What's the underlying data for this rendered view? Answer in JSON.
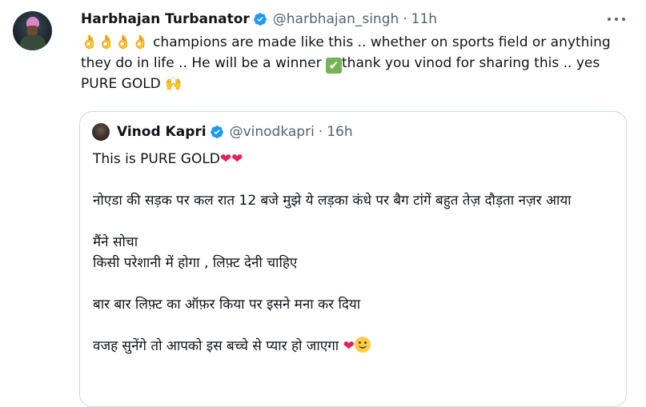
{
  "tweet": {
    "author_name": "Harbhajan Turbanator",
    "author_handle": "@harbhajan_singh",
    "dot": "·",
    "time": "11h",
    "more_icon": "more-horizontal-icon",
    "emoji_ok_hands": "👌👌👌👌",
    "text_part1": " champions are made like this .. whether on sports field or anything they do in life .. He will be a winner ",
    "emoji_check": "✔",
    "text_part2": "thank you vinod for sharing this .. yes PURE GOLD ",
    "emoji_raised_hands": "🙌"
  },
  "quote": {
    "author_name": "Vinod Kapri",
    "author_handle": "@vinodkapri",
    "dot": "·",
    "time": "16h",
    "line1_text": "This is PURE GOLD",
    "line1_hearts": "❤❤",
    "para2": "नोएडा की सड़क पर कल रात 12 बजे मुझे ये लड़का कंधे पर बैग टांगें बहुत तेज़ दौड़ता नज़र आया",
    "para3_line1": "मैंने सोचा",
    "para3_line2": "किसी परेशानी में होगा , लिफ़्ट देनी चाहिए",
    "para4": "बार बार लिफ़्ट का ऑफ़र किया पर इसने मना कर दिया",
    "para5_text": "वजह सुनेंगे तो आपको इस बच्चे से प्यार हो जाएगा ",
    "para5_heart": "❤"
  },
  "colors": {
    "verified_blue": "#1d9bf0",
    "secondary_text": "#536471",
    "border": "#cfd9de",
    "heart": "#e0245e"
  }
}
